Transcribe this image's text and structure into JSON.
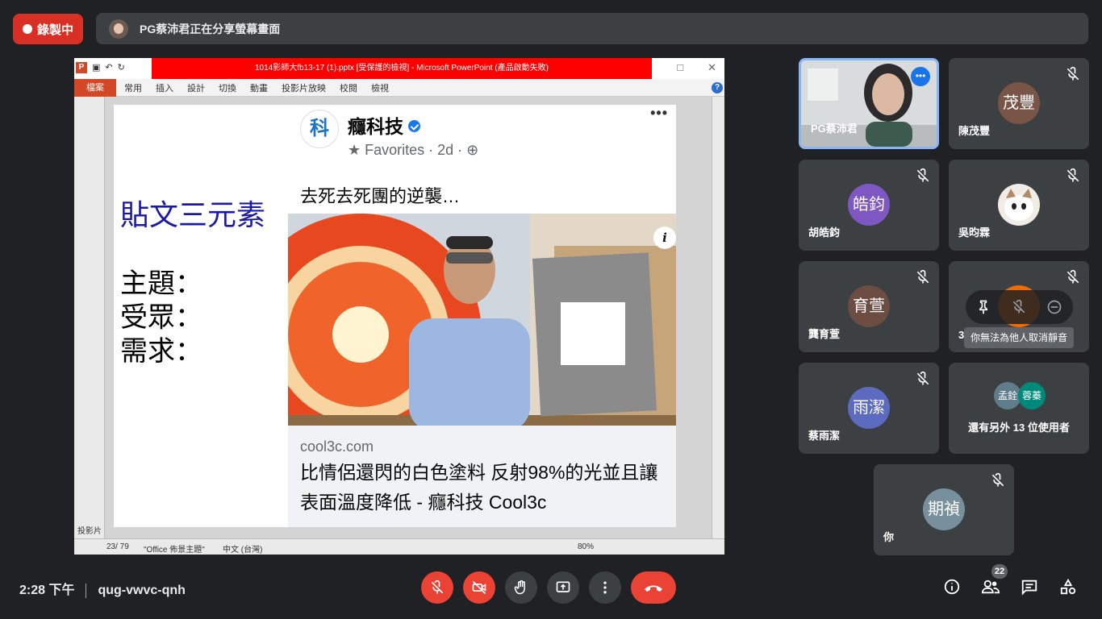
{
  "recording": {
    "label": "錄製中"
  },
  "share_banner": {
    "text": "PG蔡沛君正在分享螢幕畫面"
  },
  "powerpoint": {
    "window_title": "1014影師大fb13-17 (1).pptx [受保護的檢視] - Microsoft PowerPoint (產品啟動失敗)",
    "app_icon_letter": "P",
    "file_tab": "檔案",
    "ribbon_tabs": [
      "常用",
      "插入",
      "設計",
      "切換",
      "動畫",
      "投影片放映",
      "校閱",
      "檢視"
    ],
    "left_pane_label": "投影片",
    "status": {
      "slide_counter": "23/ 79",
      "theme": "\"Office 佈景主題\"",
      "language": "中文 (台灣)",
      "zoom": "80%"
    },
    "slide": {
      "heading": "貼文三元素",
      "lines": [
        "主題：",
        "受眾：",
        "需求："
      ],
      "post": {
        "avatar_char": "科",
        "page_name": "癮科技",
        "meta": "★ Favorites · 2d · ⊕",
        "menu": "•••",
        "text": "去死去死團的逆襲…",
        "link_domain": "cool3c.com",
        "link_title": "比情侶還閃的白色塗料 反射98%的光並且讓表面溫度降低 - 癮科技 Cool3c",
        "info_icon": "i"
      }
    }
  },
  "participants": [
    {
      "name": "PG蔡沛君",
      "initials": "",
      "color": "",
      "video": true
    },
    {
      "name": "陳茂豐",
      "initials": "茂豐",
      "color": "#795548",
      "muted": true
    },
    {
      "name": "胡皓鈞",
      "initials": "皓鈞",
      "color": "#7e57c2",
      "muted": true
    },
    {
      "name": "吳昀霖",
      "initials": "",
      "color": "#e0e0e0",
      "muted": true,
      "cat": true
    },
    {
      "name": "龔育萱",
      "initials": "育萱",
      "color": "#6d4c41",
      "muted": true
    },
    {
      "name": "3",
      "initials": "",
      "color": "#ef6c00",
      "muted": true
    },
    {
      "name": "蔡雨潔",
      "initials": "雨潔",
      "color": "#5c6bc0",
      "muted": true
    },
    {
      "name": "你",
      "initials": "期禎",
      "color": "#78909c",
      "muted": true
    }
  ],
  "others_tile": {
    "text": "還有另外 13 位使用者",
    "chips": [
      {
        "label": "孟銓",
        "color": "#607d8b"
      },
      {
        "label": "蓉蓁",
        "color": "#00897b"
      }
    ]
  },
  "tooltip": {
    "text": "你無法為他人取消靜音"
  },
  "bottom": {
    "time": "2:28 下午",
    "meeting_code": "qug-vwvc-qnh",
    "people_count": "22"
  }
}
